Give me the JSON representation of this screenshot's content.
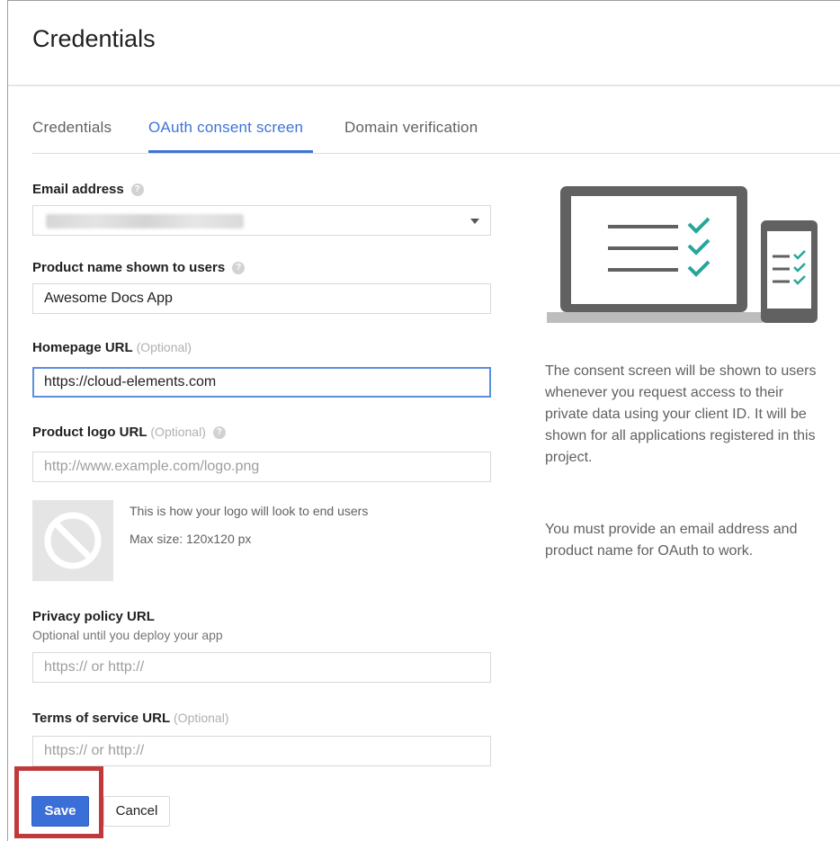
{
  "header": {
    "title": "Credentials"
  },
  "tabs": [
    {
      "label": "Credentials",
      "active": false
    },
    {
      "label": "OAuth consent screen",
      "active": true
    },
    {
      "label": "Domain verification",
      "active": false
    }
  ],
  "form": {
    "email": {
      "label": "Email address",
      "value": ""
    },
    "product_name": {
      "label": "Product name shown to users",
      "value": "Awesome Docs App"
    },
    "homepage": {
      "label": "Homepage URL",
      "optional": "(Optional)",
      "value": "https://cloud-elements.com"
    },
    "logo_url": {
      "label": "Product logo URL",
      "optional": "(Optional)",
      "placeholder": "http://www.example.com/logo.png"
    },
    "logo_preview": {
      "line1": "This is how your logo will look to end users",
      "line2": "Max size: 120x120 px"
    },
    "privacy": {
      "label": "Privacy policy URL",
      "note": "Optional until you deploy your app",
      "placeholder": "https:// or http://"
    },
    "terms": {
      "label": "Terms of service URL",
      "optional": "(Optional)",
      "placeholder": "https:// or http://"
    }
  },
  "sidebar": {
    "description_1": "The consent screen will be shown to users whenever you request access to their private data using your client ID. It will be shown for all applications registered in this project.",
    "description_2": "You must provide an email address and product name for OAuth to work."
  },
  "actions": {
    "save_label": "Save",
    "cancel_label": "Cancel"
  },
  "colors": {
    "accent": "#3f74d6",
    "check": "#26a69a",
    "highlight": "#c0393b"
  },
  "icons": {
    "help": "question-circle-icon",
    "dropdown": "chevron-down-icon",
    "no_logo": "no-image-icon"
  }
}
